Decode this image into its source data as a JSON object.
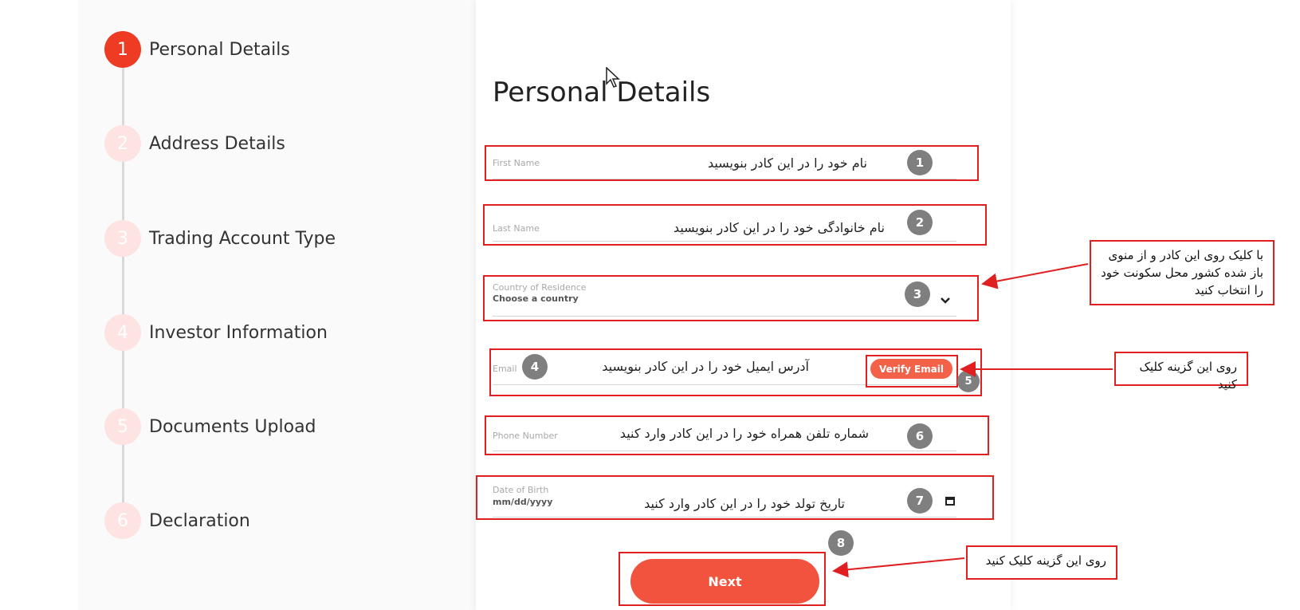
{
  "stepper": {
    "steps": [
      {
        "number": "1",
        "label": "Personal Details",
        "state": "active"
      },
      {
        "number": "2",
        "label": "Address Details",
        "state": "inactive"
      },
      {
        "number": "3",
        "label": "Trading Account Type",
        "state": "inactive"
      },
      {
        "number": "4",
        "label": "Investor Information",
        "state": "inactive"
      },
      {
        "number": "5",
        "label": "Documents Upload",
        "state": "inactive"
      },
      {
        "number": "6",
        "label": "Declaration",
        "state": "inactive"
      }
    ]
  },
  "form": {
    "title": "Personal Details",
    "first_name": {
      "label": "First Name"
    },
    "last_name": {
      "label": "Last Name"
    },
    "country": {
      "label": "Country of Residence",
      "value": "Choose a country"
    },
    "email": {
      "label": "Email",
      "verify_label": "Verify Email"
    },
    "phone": {
      "label": "Phone Number"
    },
    "dob": {
      "label": "Date of Birth",
      "value": "mm/dd/yyyy"
    },
    "next_label": "Next"
  },
  "annotations": {
    "badges": [
      "1",
      "2",
      "3",
      "4",
      "5",
      "6",
      "7",
      "8"
    ],
    "first_name_hint": "نام خود را در این کادر بنویسید",
    "last_name_hint": "نام خانوادگی خود را در این کادر بنویسید",
    "email_hint": "آدرس ایمیل خود را در این کادر بنویسید",
    "phone_hint": "شماره تلفن همراه خود را در این کادر وارد کنید",
    "dob_hint": "تاریخ تولد خود را در این کادر وارد کنید",
    "country_note": "با کلیک روی این کادر و از منوی باز شده کشور محل سکونت خود را انتخاب کنید",
    "verify_note": "روی این گزینه کلیک کنید",
    "next_note": "روی این گزینه کلیک کنید"
  },
  "colors": {
    "accent": "#ee3b24",
    "annotation": "#e02020",
    "badge": "#7f7f7f"
  },
  "icons": {
    "country_dropdown": "chevron-down-icon",
    "dob_picker": "calendar-icon",
    "pointer": "mouse-cursor-icon"
  }
}
